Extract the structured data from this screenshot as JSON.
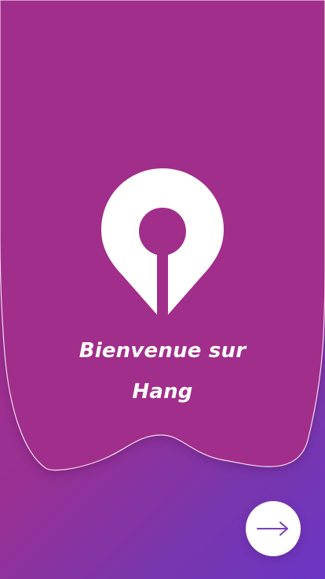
{
  "welcome": {
    "line1": "Bienvenue sur",
    "line2": "Hang"
  },
  "logo": {
    "icon": "map-pin-icon"
  },
  "next": {
    "icon": "arrow-right-icon"
  },
  "colors": {
    "background_start": "#c2338a",
    "background_end": "#6a35c4",
    "banner": "#a12d8a",
    "accent": "#7b3fb8",
    "text": "#ffffff"
  }
}
